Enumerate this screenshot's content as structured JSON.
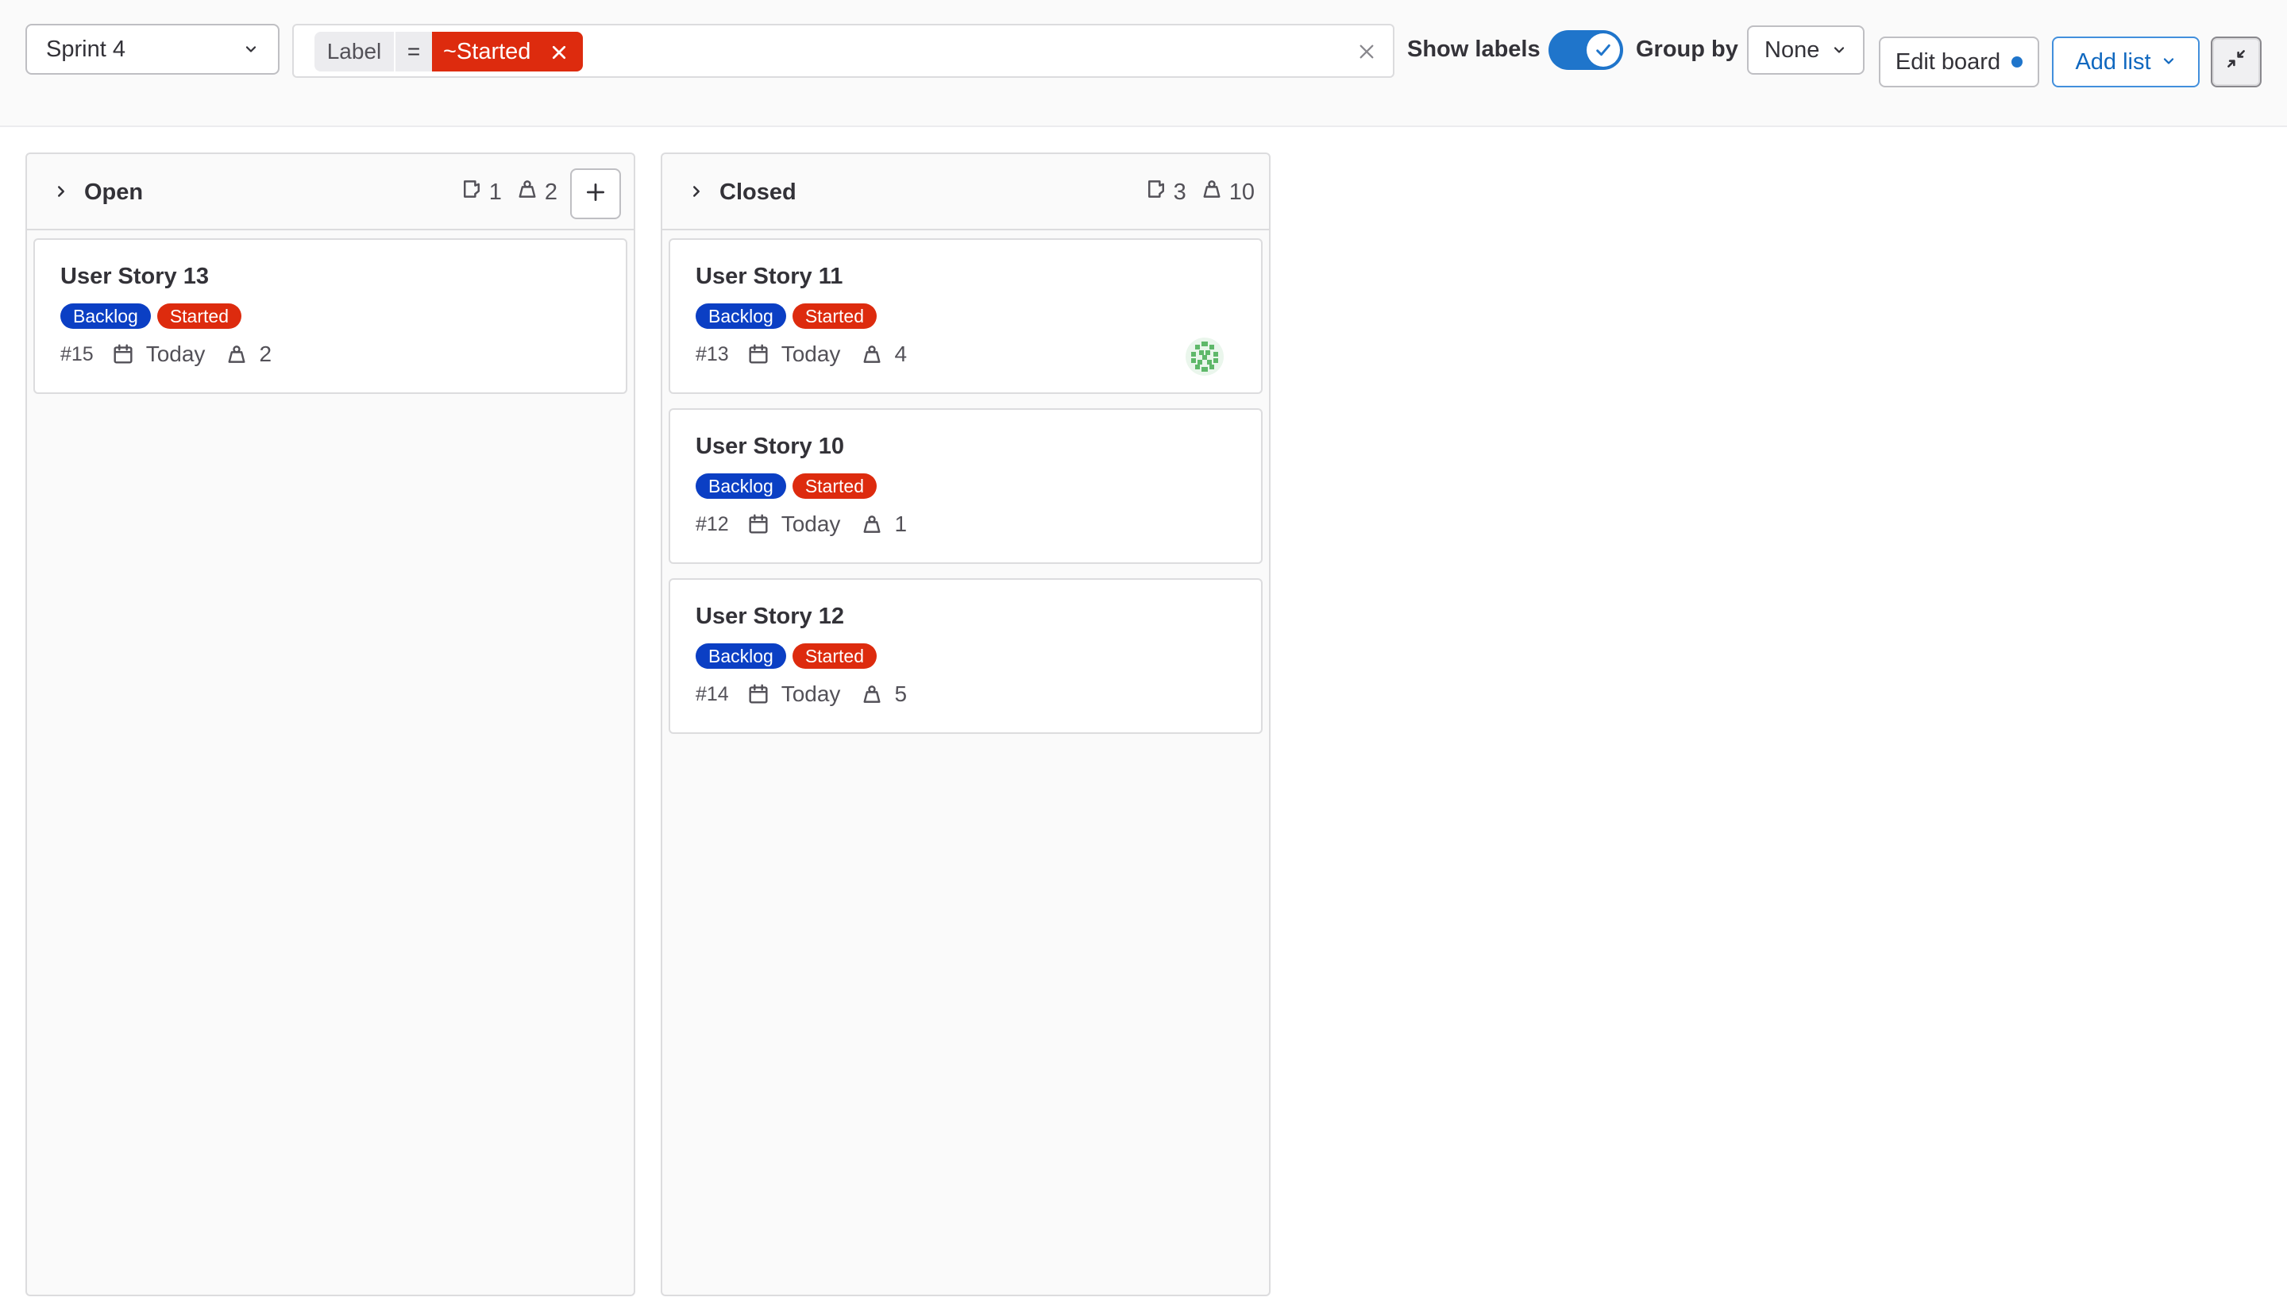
{
  "filters": {
    "iteration_select": "Sprint 4",
    "token": {
      "key": "Label",
      "operator": "=",
      "value": "~Started"
    }
  },
  "toolbar": {
    "show_labels": "Show labels",
    "show_labels_enabled": true,
    "group_by_label": "Group by",
    "group_by_value": "None",
    "edit_board": "Edit board",
    "add_list": "Add list"
  },
  "colors": {
    "accent": "#1f75cb",
    "label_backlog": "#0b3fc4",
    "label_started": "#dd2b0e"
  },
  "lists": [
    {
      "title": "Open",
      "issue_count": "1",
      "weight": "2",
      "cards": [
        {
          "title": "User Story 13",
          "labels": [
            "Backlog",
            "Started"
          ],
          "ref": "#15",
          "due": "Today",
          "weight": "2"
        }
      ]
    },
    {
      "title": "Closed",
      "issue_count": "3",
      "weight": "10",
      "cards": [
        {
          "title": "User Story 11",
          "labels": [
            "Backlog",
            "Started"
          ],
          "ref": "#13",
          "due": "Today",
          "weight": "4",
          "has_avatar": true
        },
        {
          "title": "User Story 10",
          "labels": [
            "Backlog",
            "Started"
          ],
          "ref": "#12",
          "due": "Today",
          "weight": "1"
        },
        {
          "title": "User Story 12",
          "labels": [
            "Backlog",
            "Started"
          ],
          "ref": "#14",
          "due": "Today",
          "weight": "5"
        }
      ]
    }
  ]
}
